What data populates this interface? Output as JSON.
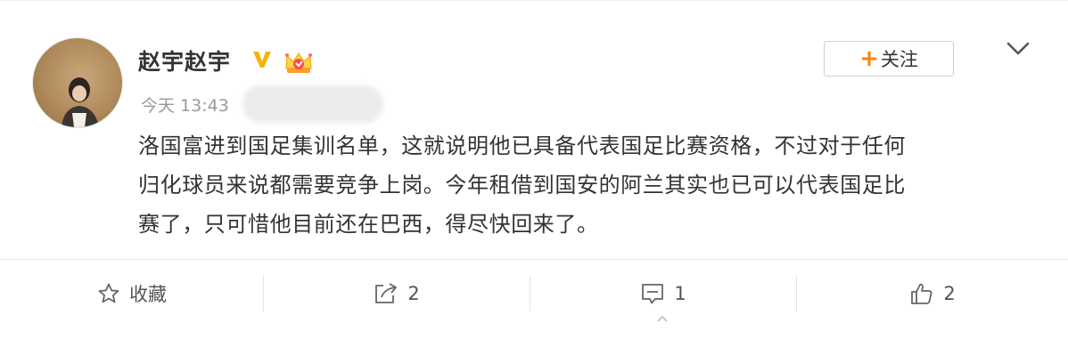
{
  "post": {
    "username": "赵宇赵宇",
    "time": "今天 13:43",
    "follow_label": "关注",
    "follow_plus": "+",
    "text_lines": [
      "洛国富进到国足集训名单，这就说明他已具备代表国足比赛资格，不过对于任何",
      "归化球员来说都需要竞争上岗。今年租借到国安的阿兰其实也已可以代表国足比",
      "赛了，只可惜他目前还在巴西，得尽快回来了。"
    ]
  },
  "actions": {
    "favorite_label": "收藏",
    "repost_count": "2",
    "comment_count": "1",
    "like_count": "2"
  },
  "icons": [
    "avatar",
    "verified-v-icon",
    "crown-icon",
    "chevron-down-icon",
    "star-icon",
    "share-icon",
    "comment-icon",
    "thumbs-up-icon"
  ],
  "colors": {
    "accent_orange": "#ff8200",
    "verified_yellow": "#f5b400",
    "text": "#333333",
    "muted": "#9a9a9a"
  }
}
